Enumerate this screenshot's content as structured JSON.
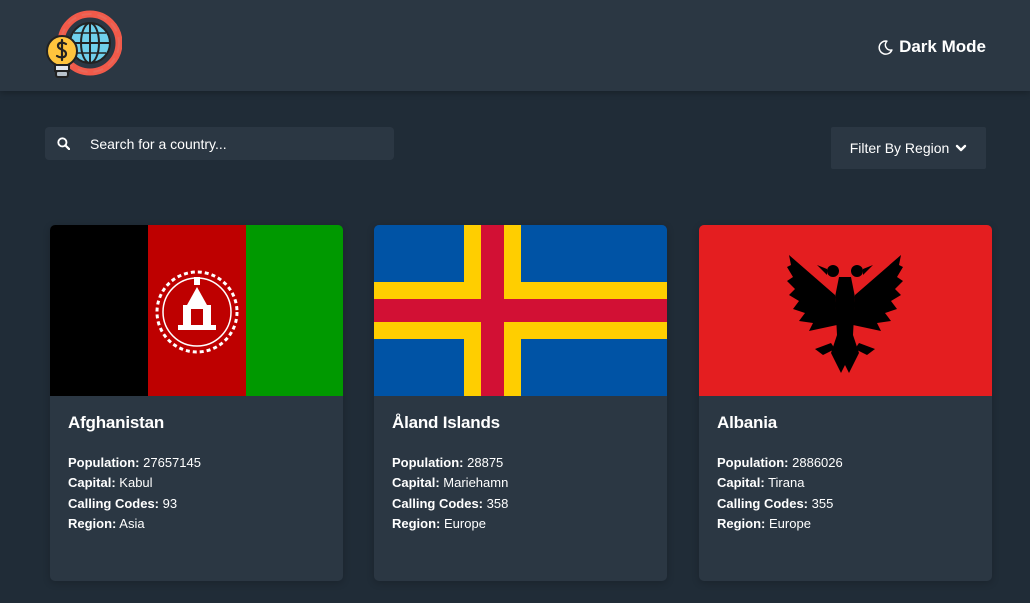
{
  "header": {
    "theme_label": "Dark Mode",
    "logo_icon": "globe-dollar-bulb-icon",
    "theme_icon": "moon-icon"
  },
  "search": {
    "placeholder": "Search for a country...",
    "icon": "search-icon"
  },
  "filter": {
    "label": "Filter By Region",
    "icon": "chevron-down-icon"
  },
  "labels": {
    "population": "Population:",
    "capital": "Capital:",
    "calling_codes": "Calling Codes:",
    "region": "Region:"
  },
  "countries": [
    {
      "name": "Afghanistan",
      "population": "27657145",
      "capital": "Kabul",
      "calling_codes": "93",
      "region": "Asia",
      "flag": "afghanistan-flag"
    },
    {
      "name": "Åland Islands",
      "population": "28875",
      "capital": "Mariehamn",
      "calling_codes": "358",
      "region": "Europe",
      "flag": "aland-islands-flag"
    },
    {
      "name": "Albania",
      "population": "2886026",
      "capital": "Tirana",
      "calling_codes": "355",
      "region": "Europe",
      "flag": "albania-flag"
    }
  ],
  "colors": {
    "background": "#202c37",
    "element": "#2b3743",
    "text": "#ffffff"
  }
}
